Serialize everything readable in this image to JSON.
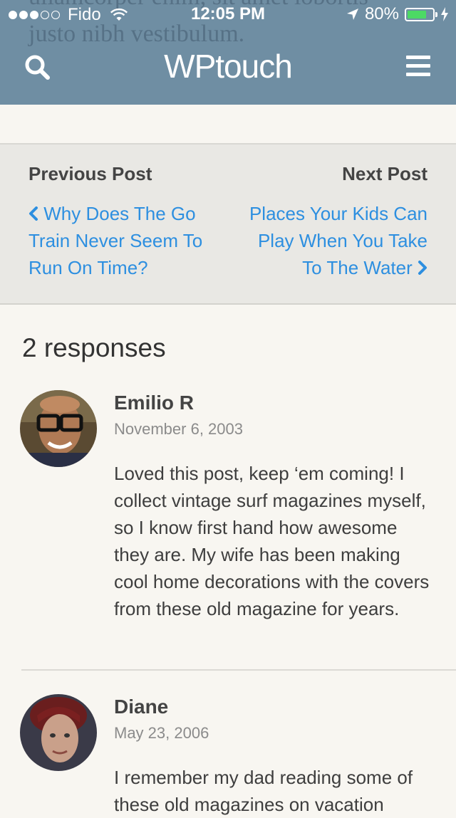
{
  "status_bar": {
    "carrier": "Fido",
    "time": "12:05 PM",
    "battery": "80%",
    "battery_level": 0.8
  },
  "header": {
    "background_text": [
      "ullamcorper enim, sit amet lobortis",
      "justo nibh vestibulum."
    ],
    "site_title": "WPtouch",
    "search_icon": "search-icon",
    "menu_icon": "hamburger-menu-icon"
  },
  "post_nav": {
    "previous_heading": "Previous Post",
    "previous_title": "Why Does The Go Train Never Seem To Run On Time?",
    "next_heading": "Next Post",
    "next_title": "Places Your Kids Can Play When You Take To The Water"
  },
  "comments": {
    "count_label": "2 responses",
    "items": [
      {
        "author": "Emilio R",
        "date": "November 6, 2003",
        "body": "Loved this post, keep ‘em coming! I collect vintage surf magazines myself, so I know first hand how awesome they are. My wife has been making cool home decorations with the covers from these old magazine for years."
      },
      {
        "author": "Diane",
        "date": "May 23, 2006",
        "body": "I remember my dad reading some of these old magazines on vacation"
      }
    ]
  },
  "colors": {
    "header_bg": "#6f8ea3",
    "link": "#2d8fe0",
    "page_bg": "#f8f6f1",
    "nav_bg": "#e9e8e4",
    "battery_green": "#4cd964"
  }
}
